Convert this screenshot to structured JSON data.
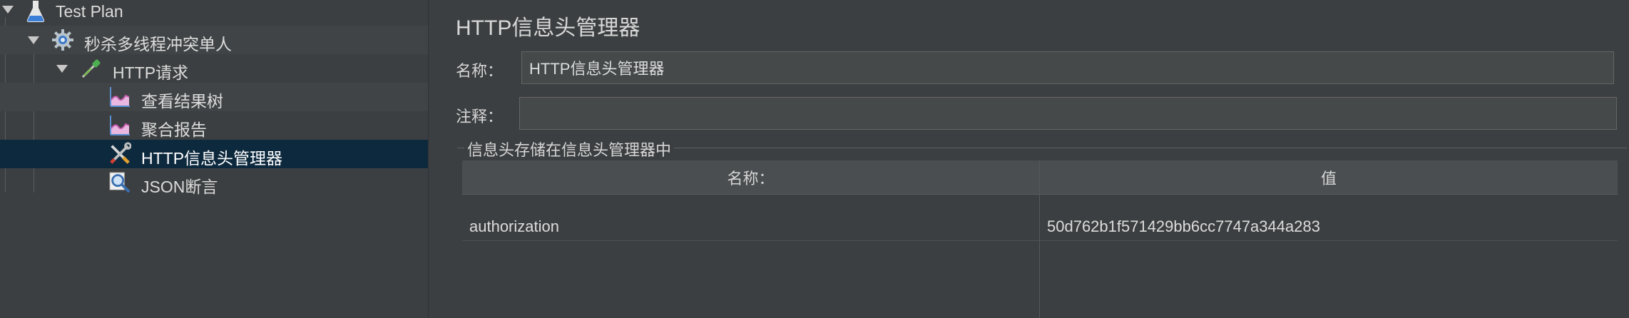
{
  "tree": {
    "items": [
      {
        "label": "Test Plan",
        "icon": "flask-icon"
      },
      {
        "label": "秒杀多线程冲突单人",
        "icon": "gear-icon"
      },
      {
        "label": "HTTP请求",
        "icon": "pipette-icon"
      },
      {
        "label": "查看结果树",
        "icon": "chart-icon"
      },
      {
        "label": "聚合报告",
        "icon": "chart-icon"
      },
      {
        "label": "HTTP信息头管理器",
        "icon": "wrench-screwdriver-icon"
      },
      {
        "label": "JSON断言",
        "icon": "magnifier-icon"
      }
    ]
  },
  "panel": {
    "title": "HTTP信息头管理器",
    "name_label": "名称：",
    "name_value": "HTTP信息头管理器",
    "comment_label": "注释：",
    "comment_value": "",
    "section_title": "信息头存储在信息头管理器中",
    "table": {
      "headers": [
        "名称：",
        "值"
      ],
      "rows": [
        [
          "authorization",
          "50d762b1f571429bb6cc7747a344a283"
        ]
      ]
    }
  },
  "colors": {
    "background": "#3c3f41",
    "selected_row": "#0d293e",
    "text": "#d6d6d6"
  }
}
